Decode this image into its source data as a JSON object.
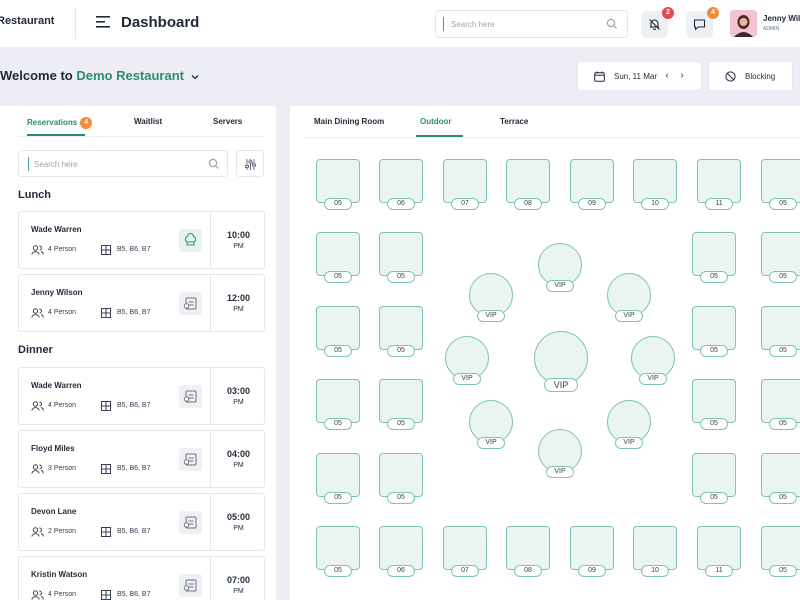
{
  "header": {
    "brand": "Restaurant",
    "title": "Dashboard",
    "search_placeholder": "Search here",
    "notifications_count": "2",
    "messages_count": "4",
    "user_name": "Jenny Wil",
    "user_role": "ADMIN"
  },
  "welcome": {
    "prefix": "Welcome to",
    "restaurant": "Demo Restaurant"
  },
  "date_nav": {
    "date": "Sun, 11 Mar",
    "prev": "‹",
    "next": "›"
  },
  "blocking_label": "Blocking",
  "left_tabs": [
    {
      "label": "Reservations",
      "count": "4"
    },
    {
      "label": "Waitlist"
    },
    {
      "label": "Servers"
    }
  ],
  "left_search_placeholder": "Search here",
  "sections": {
    "lunch": "Lunch",
    "dinner": "Dinner"
  },
  "reservations": [
    {
      "name": "Wade Warren",
      "persons": "4 Person",
      "tables": "B5, B6, B7",
      "time": "10:00",
      "ampm": "PM"
    },
    {
      "name": "Jenny Wilson",
      "persons": "4 Person",
      "tables": "B5, B6, B7",
      "time": "12:00",
      "ampm": "PM"
    },
    {
      "name": "Wade Warren",
      "persons": "4 Person",
      "tables": "B5, B6, B7",
      "time": "03:00",
      "ampm": "PM"
    },
    {
      "name": "Floyd Miles",
      "persons": "3 Person",
      "tables": "B5, B6, B7",
      "time": "04:00",
      "ampm": "PM"
    },
    {
      "name": "Devon Lane",
      "persons": "2 Person",
      "tables": "B5, B6, B7",
      "time": "05:00",
      "ampm": "PM"
    },
    {
      "name": "Kristin Watson",
      "persons": "4 Person",
      "tables": "B5, B6, B7",
      "time": "07:00",
      "ampm": "PM"
    }
  ],
  "floor_tabs": [
    {
      "label": "Main Dining Room"
    },
    {
      "label": "Outdoor"
    },
    {
      "label": "Terrace"
    }
  ],
  "floor": {
    "top_row": [
      "05",
      "06",
      "07",
      "08",
      "09",
      "10",
      "11",
      "05"
    ],
    "bottom_row": [
      "05",
      "06",
      "07",
      "08",
      "09",
      "10",
      "11",
      "05"
    ],
    "left_col_a": [
      "05",
      "05",
      "05",
      "05"
    ],
    "left_col_b": [
      "05",
      "05",
      "05",
      "05"
    ],
    "right_col_a": [
      "05",
      "05",
      "05",
      "05"
    ],
    "right_col_b": [
      "05",
      "05",
      "05",
      "05"
    ],
    "vip_label": "VIP",
    "center_vip_label": "VIP"
  },
  "colors": {
    "accent": "#2e8b6b",
    "badge_red": "#e5484d",
    "badge_orange": "#f58a3a",
    "table_fill": "#eaf5f1",
    "table_border": "#7ec5a9"
  }
}
